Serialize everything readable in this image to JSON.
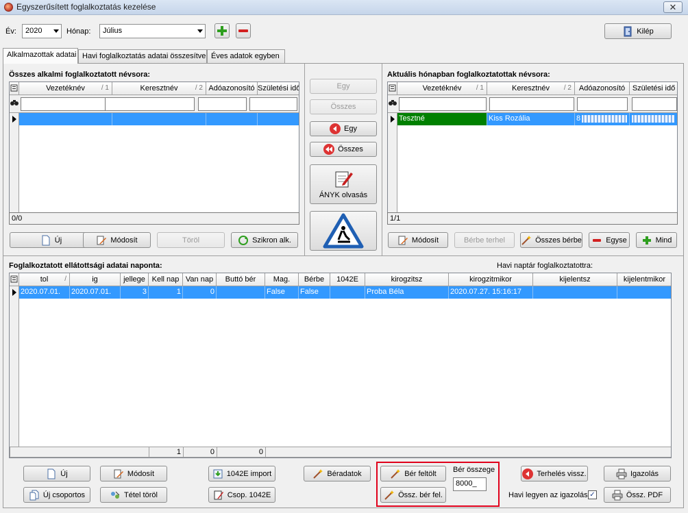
{
  "window": {
    "title": "Egyszerűsített foglalkoztatás kezelése",
    "close_glyph": "✕"
  },
  "toolbar": {
    "year_label": "Év:",
    "year_value": "2020",
    "month_label": "Hónap:",
    "month_value": "Július",
    "exit_label": "Kilép"
  },
  "tabs": [
    {
      "label": "Alkalmazottak adatai"
    },
    {
      "label": "Havi foglalkoztatás adatai összesítve"
    },
    {
      "label": "Éves adatok egyben"
    }
  ],
  "left_grid": {
    "title": "Összes alkalmi foglalkoztatott névsora:",
    "columns": [
      "Vezetéknév",
      "Keresztnév",
      "Adóazonosító",
      "Születési idő"
    ],
    "sort_marks": [
      "/ 1",
      "/ 2"
    ],
    "status": "0/0",
    "buttons": {
      "new": "Új",
      "edit": "Módosít",
      "delete": "Töröl",
      "sync": "Szikron alk."
    }
  },
  "middle": {
    "one_right": "Egy",
    "all_right": "Összes",
    "one_left": "Egy",
    "all_left": "Összes",
    "anyk": "ÁNYK olvasás"
  },
  "right_grid": {
    "title": "Aktuális hónapban foglalkoztatottak névsora:",
    "columns": [
      "Vezetéknév",
      "Keresztnév",
      "Adóazonosító",
      "Születési idő"
    ],
    "sort_marks": [
      "/ 1",
      "/ 2"
    ],
    "row": {
      "last": "Tesztné",
      "first": "Kiss Rozália",
      "tax_id": "8"
    },
    "status": "1/1",
    "buttons": {
      "edit": "Módosít",
      "to_wage": "Bérbe terhel",
      "all_wage": "Összes bérbe",
      "one": "Egyse",
      "all": "Mind"
    }
  },
  "daily_grid": {
    "title": "Foglalkoztatott ellátottsági adatai naponta:",
    "right_note": "Havi naptár foglalkoztatottra:",
    "columns": [
      "tol",
      "ig",
      "jellege",
      "Kell nap",
      "Van nap",
      "Buttó bér",
      "Mag.",
      "Bérbe",
      "1042E",
      "kirogzitsz",
      "kirogzitmikor",
      "kijelentsz",
      "kijelentmikor"
    ],
    "row": [
      "2020.07.01.",
      "2020.07.01.",
      "3",
      "1",
      "0",
      "",
      "False",
      "False",
      "",
      "Proba Béla",
      "2020.07.27. 15:16:17",
      "",
      ""
    ],
    "footer_sums": [
      "1",
      "0",
      "0"
    ]
  },
  "bottom": {
    "new": "Új",
    "edit": "Módosít",
    "new_group": "Új csoportos",
    "delete_item": "Tétel töröl",
    "import_1042e": "1042E import",
    "group_1042e": "Csop. 1042E",
    "wage_data": "Béradatok",
    "wage_upload": "Bér feltölt",
    "total_wage": "Össz. bér fel.",
    "wage_amount_label": "Bér összege",
    "wage_amount_value": "8000_",
    "charge_back": "Terhelés vissz.",
    "certificate": "Igazolás",
    "monthly_cert_label": "Havi legyen az igazolás",
    "monthly_cert_checked": "✓",
    "total_pdf": "Össz. PDF"
  },
  "colors": {
    "selection": "#3399ff",
    "green_row": "#008000",
    "highlight_box": "#e0001b"
  }
}
